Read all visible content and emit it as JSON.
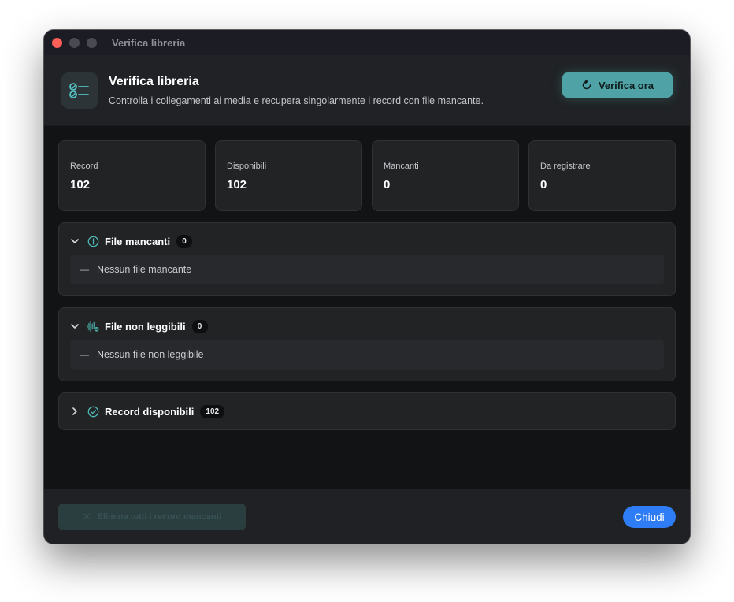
{
  "window": {
    "title": "Verifica libreria"
  },
  "header": {
    "title": "Verifica libreria",
    "subtitle": "Controlla i collegamenti ai media e recupera singolarmente i record con file mancante.",
    "verify_label": "Verifica ora",
    "icon": "checklist-icon"
  },
  "stats": [
    {
      "label": "Record",
      "value": "102"
    },
    {
      "label": "Disponibili",
      "value": "102"
    },
    {
      "label": "Mancanti",
      "value": "0"
    },
    {
      "label": "Da registrare",
      "value": "0"
    }
  ],
  "sections": {
    "missing": {
      "title": "File mancanti",
      "count": "0",
      "empty": "Nessun file mancante",
      "expanded": true,
      "icon": "alert-circle-icon"
    },
    "unreadable": {
      "title": "File non leggibili",
      "count": "0",
      "empty": "Nessun file non leggibile",
      "expanded": true,
      "icon": "waveform-icon"
    },
    "available": {
      "title": "Record disponibili",
      "count": "102",
      "expanded": false,
      "icon": "check-circle-icon"
    }
  },
  "footer": {
    "delete_label": "Elimina tutti i record mancanti",
    "delete_icon": "close-icon",
    "close_label": "Chiudi"
  },
  "colors": {
    "accent": "#4fa3a6",
    "primary": "#2f7df6",
    "close_dot": "#fe5f57"
  }
}
